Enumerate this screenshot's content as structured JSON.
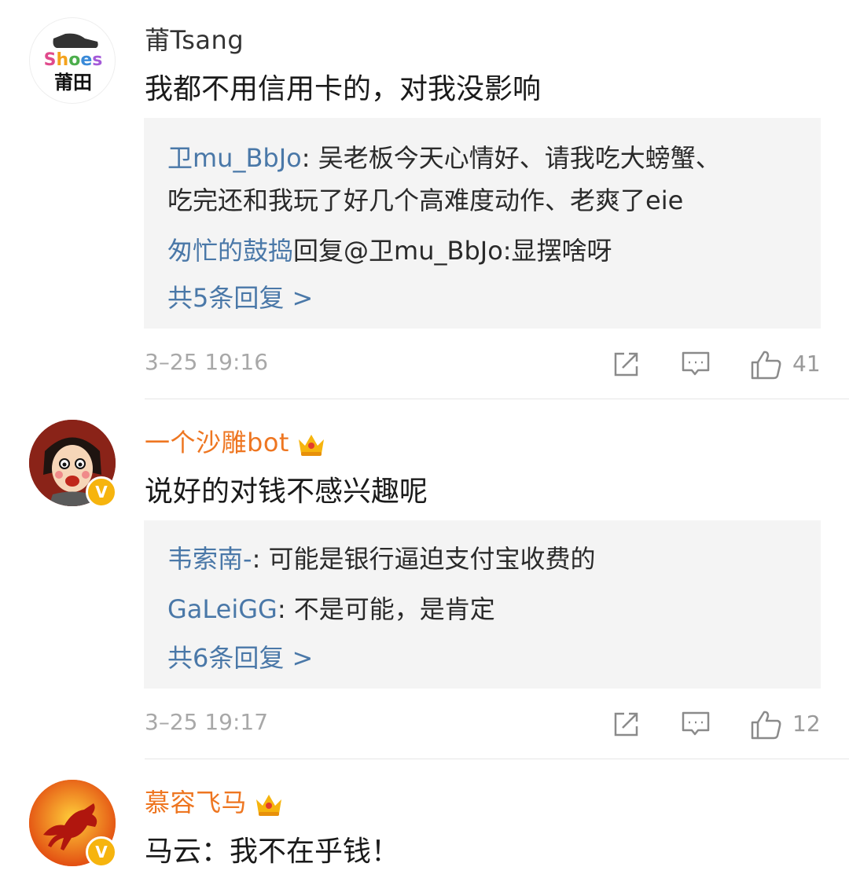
{
  "comments": [
    {
      "avatar_icon": "shoes-putian-logo",
      "avatar_text_top": "Shoes",
      "avatar_text_bottom": "莆田",
      "username": "莆Tsang",
      "username_style": "plain",
      "text": "我都不用信用卡的，对我没影响",
      "replies": [
        {
          "name": "卫mu_BbJo",
          "sep": ": ",
          "content": "吴老板今天心情好、请我吃大螃蟹、"
        },
        {
          "name": "",
          "sep": "",
          "content": "吃完还和我玩了好几个高难度动作、老爽了eie"
        },
        {
          "name": "匆忙的鼓捣",
          "sep": "回复",
          "content": "@卫mu_BbJo:显摆啥呀"
        }
      ],
      "more": "共5条回复 >",
      "time": "3–25 19:16",
      "likes": "41"
    },
    {
      "avatar_icon": "cartoon-face-avatar",
      "username": "一个沙雕bot",
      "username_style": "vip",
      "verified": true,
      "text": "说好的对钱不感兴趣呢",
      "replies": [
        {
          "name": "韦索南-",
          "sep": ": ",
          "content": "可能是银行逼迫支付宝收费的"
        },
        {
          "name": "GaLeiGG",
          "sep": ": ",
          "content": "不是可能，是肯定"
        }
      ],
      "more": "共6条回复 >",
      "time": "3–25 19:17",
      "likes": "12"
    },
    {
      "avatar_icon": "running-horse-avatar",
      "username": "慕容飞马",
      "username_style": "vip",
      "verified": true,
      "text": "马云：我不在乎钱！"
    }
  ],
  "badge_text": "V",
  "colors": {
    "link_blue": "#4a78a8",
    "vip_orange": "#ee7621",
    "reply_bg": "#f4f4f4",
    "meta_gray": "#a8a8a8",
    "verified_gold": "#f6b40e"
  }
}
